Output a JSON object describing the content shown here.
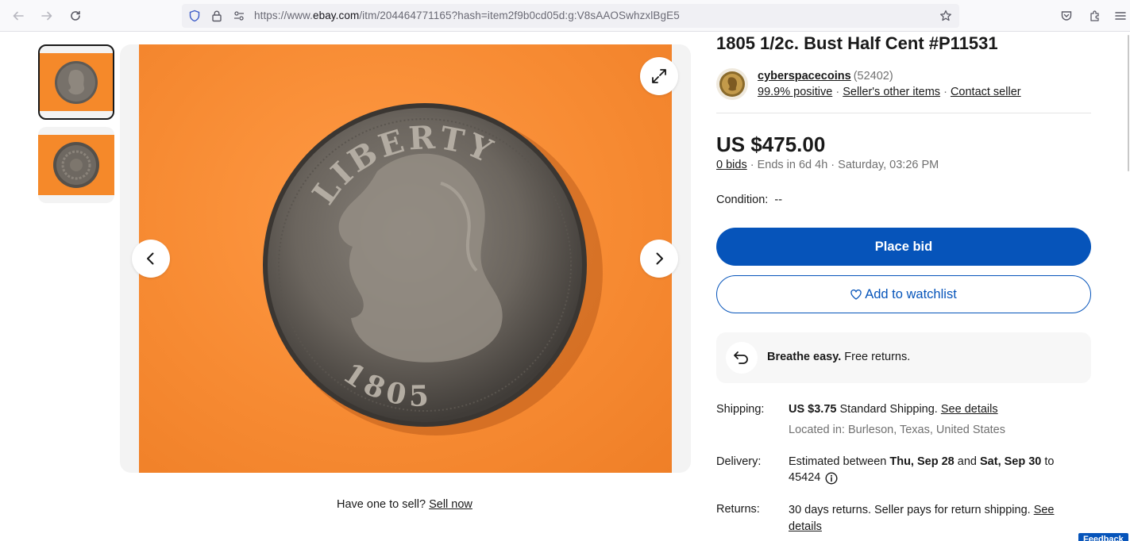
{
  "browser": {
    "url_prefix": "https://www.",
    "url_domain": "ebay.com",
    "url_path": "/itm/204464771165?hash=item2f9b0cd05d:g:V8sAAOSwhzxlBgE5"
  },
  "gallery": {
    "coin_inscription": "LIBERTY",
    "coin_year": "1805"
  },
  "sell": {
    "question": "Have one to sell?",
    "link": "Sell now"
  },
  "listing": {
    "title": "1805 1/2c. Bust Half Cent #P11531",
    "seller_name": "cyberspacecoins",
    "seller_count": "(52402)",
    "positive": "99.9% positive",
    "sep1": " · ",
    "other_items": "Seller's other items",
    "sep2": " · ",
    "contact": "Contact seller",
    "price": "US $475.00",
    "bids": "0 bids",
    "ends": " · Ends in 6d 4h · Saturday, 03:26 PM",
    "condition_label": "Condition:",
    "condition_value": "--",
    "place_bid": "Place bid",
    "watchlist": "Add to watchlist",
    "returns_bold": "Breathe easy.",
    "returns_rest": " Free returns."
  },
  "details": {
    "shipping_label": "Shipping:",
    "shipping_cost": "US $3.75",
    "shipping_method": " Standard Shipping. ",
    "shipping_link": "See details",
    "located": "Located in: Burleson, Texas, United States",
    "delivery_label": "Delivery:",
    "delivery_pre": "Estimated between ",
    "delivery_start": "Thu, Sep 28",
    "delivery_and": " and ",
    "delivery_end": "Sat, Sep 30",
    "delivery_to": " to",
    "delivery_zip": "45424",
    "returns_label": "Returns:",
    "returns_text": "30 days returns. Seller pays for return shipping. ",
    "returns_link1": "See",
    "returns_link2": "details"
  },
  "feedback": "Feedback",
  "colors": {
    "accent": "#0654ba",
    "background_orange": "#f78b33",
    "text": "#191919",
    "muted": "#707070"
  }
}
